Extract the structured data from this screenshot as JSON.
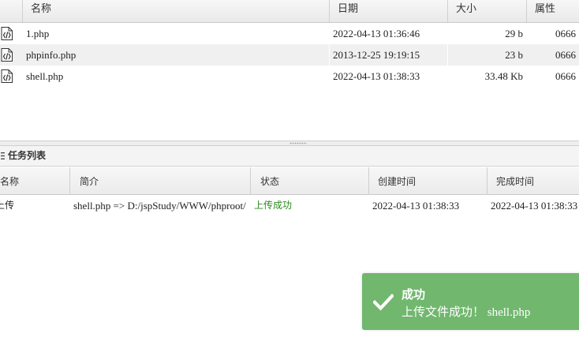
{
  "file_list": {
    "columns": {
      "name": "名称",
      "date": "日期",
      "size": "大小",
      "attr": "属性"
    },
    "rows": [
      {
        "name": "1.php",
        "date": "2022-04-13 01:36:46",
        "size": "29 b",
        "attr": "0666",
        "icon": "php-file-icon"
      },
      {
        "name": "phpinfo.php",
        "date": "2013-12-25 19:19:15",
        "size": "23 b",
        "attr": "0666",
        "icon": "php-file-icon"
      },
      {
        "name": "shell.php",
        "date": "2022-04-13 01:38:33",
        "size": "33.48 Kb",
        "attr": "0666",
        "icon": "php-file-icon"
      }
    ]
  },
  "task_panel": {
    "title": "任务列表",
    "title_icon": "list-icon",
    "columns": {
      "name": "名称",
      "desc": "简介",
      "status": "状态",
      "created": "创建时间",
      "finished": "完成时间"
    },
    "rows": [
      {
        "name": "上传",
        "desc": "shell.php => D:/jspStudy/WWW/phproot/",
        "status": "上传成功",
        "created": "2022-04-13 01:38:33",
        "finished": "2022-04-13 01:38:33"
      }
    ]
  },
  "toast": {
    "title": "成功",
    "message": "上传文件成功！ shell.php",
    "icon": "check-icon",
    "background": "#71b76e"
  },
  "colors": {
    "success_text": "#2c8a1e",
    "alt_row": "#f0f0f0"
  }
}
